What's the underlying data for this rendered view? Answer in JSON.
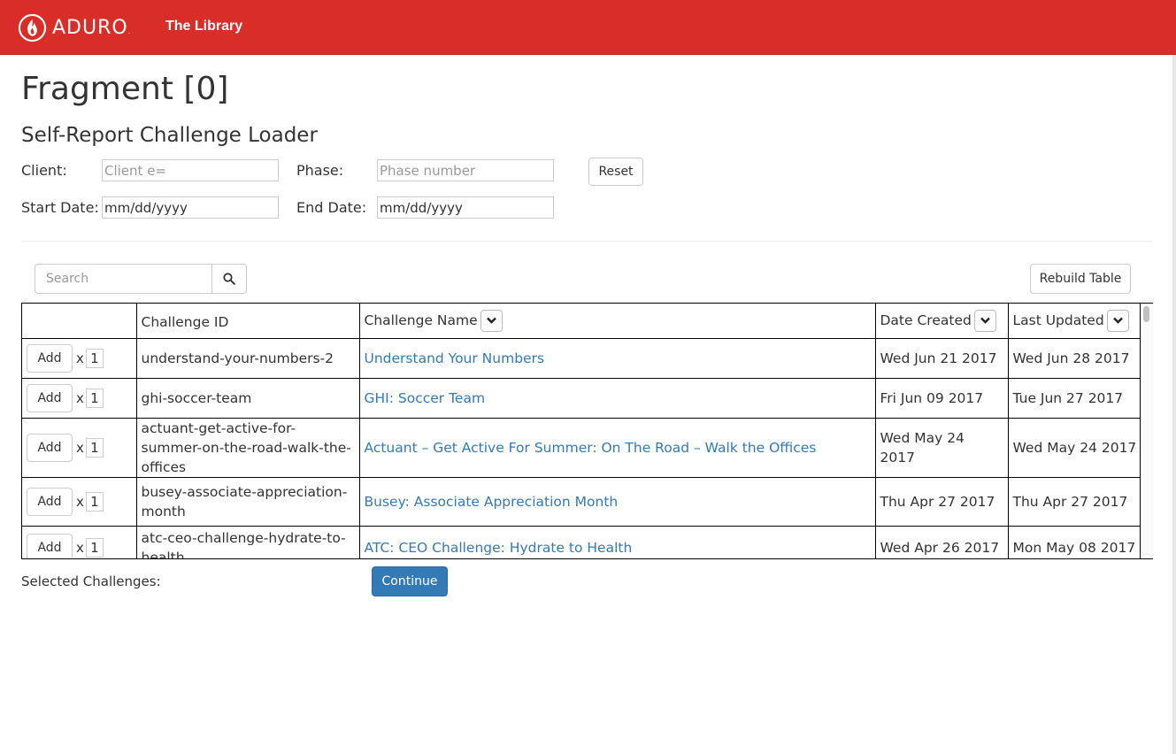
{
  "navbar": {
    "brand": "ADURO",
    "brand_mark": ".",
    "logo_icon": "flame-icon",
    "link": "The Library",
    "background": "#d92d27"
  },
  "page": {
    "title": "Fragment [0]",
    "subtitle": "Self-Report Challenge Loader"
  },
  "form": {
    "client_label": "Client:",
    "client_placeholder": "Client e=",
    "phase_label": "Phase:",
    "phase_placeholder": "Phase number",
    "reset_label": "Reset",
    "start_label": "Start Date:",
    "start_value": "mm/dd/yyyy",
    "end_label": "End Date:",
    "end_value": "mm/dd/yyyy"
  },
  "toolbar": {
    "search_placeholder": "Search",
    "search_icon": "search-icon",
    "rebuild_label": "Rebuild Table"
  },
  "table": {
    "headers": [
      "",
      "Challenge ID",
      "Challenge Name",
      "Date Created",
      "Last Updated"
    ],
    "add_label": "Add",
    "times": "x",
    "rows": [
      {
        "qty": "1",
        "id": "understand-your-numbers-2",
        "name": "Understand Your Numbers",
        "created": "Wed Jun 21 2017",
        "updated": "Wed Jun 28 2017"
      },
      {
        "qty": "1",
        "id": "ghi-soccer-team",
        "name": "GHI: Soccer Team",
        "created": "Fri Jun 09 2017",
        "updated": "Tue Jun 27 2017"
      },
      {
        "qty": "1",
        "id": "actuant-get-active-for-summer-on-the-road-walk-the-offices",
        "name": "Actuant – Get Active For Summer: On The Road – Walk the Offices",
        "created": "Wed May 24 2017",
        "updated": "Wed May 24 2017"
      },
      {
        "qty": "1",
        "id": "busey-associate-appreciation-month",
        "name": "Busey: Associate Appreciation Month",
        "created": "Thu Apr 27 2017",
        "updated": "Thu Apr 27 2017"
      },
      {
        "qty": "1",
        "id": "atc-ceo-challenge-hydrate-to-health",
        "name": "ATC: CEO Challenge: Hydrate to Health",
        "created": "Wed Apr 26 2017",
        "updated": "Mon May 08 2017"
      }
    ]
  },
  "footer": {
    "selected_label": "Selected Challenges:",
    "continue_label": "Continue"
  },
  "colors": {
    "primary": "#337ab7",
    "link": "#337ab7"
  }
}
